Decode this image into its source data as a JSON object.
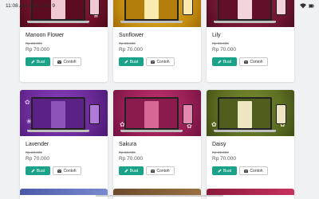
{
  "status_bar": {
    "time": "11:08 AM Mon, Dec 9"
  },
  "buttons": {
    "buat_label": "Buat",
    "contoh_label": "Contoh"
  },
  "templates": [
    {
      "name": "Manoon Flower",
      "old_price": "Rp 80.000",
      "price": "Rp 70.000",
      "theme_color": "#7e1630"
    },
    {
      "name": "Sunflower",
      "old_price": "Rp 80.000",
      "price": "Rp 70.000",
      "theme_color": "#d19c16"
    },
    {
      "name": "Lily",
      "old_price": "Rp 80.000",
      "price": "Rp 70.000",
      "theme_color": "#7d1d3a"
    },
    {
      "name": "Lavender",
      "old_price": "Rp 80.000",
      "price": "Rp 70.000",
      "theme_color": "#6a2a97"
    },
    {
      "name": "Sakura",
      "old_price": "Rp 80.000",
      "price": "Rp 70.000",
      "theme_color": "#a3245a"
    },
    {
      "name": "Daisy",
      "old_price": "Rp 80.000",
      "price": "Rp 70.000",
      "theme_color": "#5d6f22"
    }
  ],
  "colors": {
    "accent": "#1aa388",
    "background": "#f0f1f3",
    "card": "#ffffff"
  }
}
